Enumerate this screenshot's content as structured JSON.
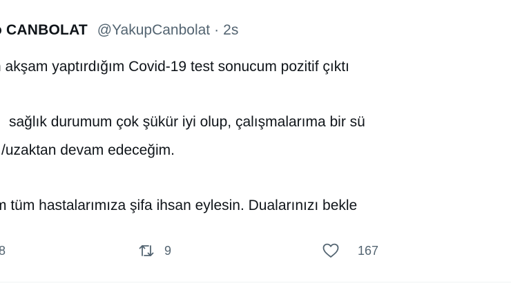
{
  "tweet": {
    "author_name": "o CANBOLAT",
    "handle": "@YakupCanbolat",
    "separator": "·",
    "time": "2s",
    "lines": [
      "n akşam yaptırdığım Covid-19 test sonucum pozitif çıktı",
      "sağlık durumum çok şükür iyi olup, çalışmalarıma bir sü",
      "/uzaktan devam edeceğim.",
      "m tüm hastalarımıza şifa ihsan eylesin. Dualarınızı bekle"
    ],
    "reply_count": "8",
    "retweet_count": "9",
    "like_count": "167"
  },
  "icons": {
    "retweet": "retweet-icon",
    "like": "heart-icon"
  },
  "colors": {
    "text": "#0f1419",
    "secondary": "#536471",
    "background": "#ffffff"
  }
}
